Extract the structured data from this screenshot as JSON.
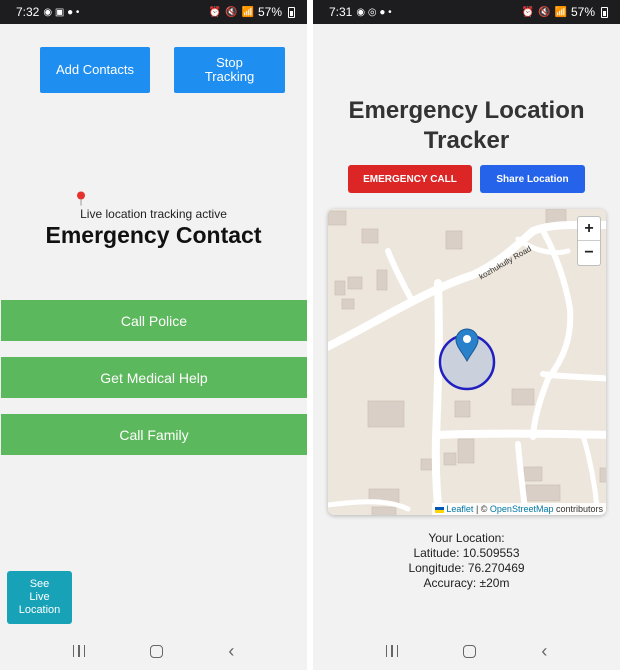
{
  "left_phone": {
    "status": {
      "time": "7:32",
      "battery": "57%",
      "network": "Vo) LTE"
    },
    "buttons": {
      "add_contacts": "Add Contacts",
      "stop_tracking": "Stop\nTracking"
    },
    "tracking_status": "Live location tracking active",
    "title": "Emergency Contact",
    "actions": {
      "call_police": "Call Police",
      "medical_help": "Get Medical Help",
      "call_family": "Call Family"
    },
    "see_live_location": "See\nLive\nLocation",
    "colors": {
      "primary": "#1f8ef1",
      "action": "#5cb85c",
      "secondary": "#17a2b8"
    }
  },
  "right_phone": {
    "status": {
      "time": "7:31",
      "battery": "57%",
      "network": "Vo) LTE"
    },
    "title": "Emergency Location Tracker",
    "buttons": {
      "emergency_call": "EMERGENCY CALL",
      "share_location": "Share Location"
    },
    "map": {
      "road_label": "kozhukully Road",
      "zoom_in": "+",
      "zoom_out": "−",
      "attribution_leaflet": "Leaflet",
      "attribution_sep": " | © ",
      "attribution_osm": "OpenStreetMap",
      "attribution_tail": " contributors"
    },
    "location": {
      "heading": "Your Location:",
      "latitude": "Latitude: 10.509553",
      "longitude": "Longitude: 76.270469",
      "accuracy": "Accuracy: ±20m"
    },
    "colors": {
      "danger": "#dc2626",
      "primary": "#2563eb",
      "accuracy_circle": "#2020c0"
    }
  }
}
